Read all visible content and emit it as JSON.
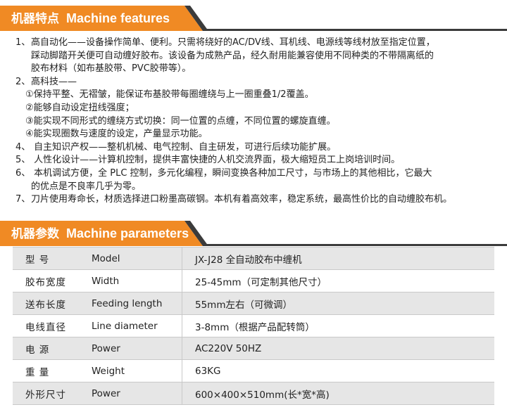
{
  "features_banner": {
    "cn": "机器特点",
    "en": "Machine features"
  },
  "features": [
    {
      "num": "1、",
      "lines": [
        "高自动化——设备操作简单、便利。只需将绕好的AC/DV线、耳机线、电源线等线材放至指定位置，",
        "踩动脚踏开关便可自动缠好胶布。该设备为成熟产品，经久耐用能兼容使用不同种类的不带隔离纸的",
        "胶布材料（如布基胶带、PVC胶带等）。"
      ]
    },
    {
      "num": "2、",
      "lines": [
        "高科技——"
      ]
    },
    {
      "sub": [
        "①保持平整、无褶皱，能保证布基胶带每圈缠绕与上一圈重叠1/2覆盖。",
        "②能够自动设定扭线强度；",
        "③能实现不同形式的缠绕方式切换：同一位置的点缠，不同位置的螺旋直缠。",
        "④能实现圈数与速度的设定，产量显示功能。"
      ]
    },
    {
      "num": "4、",
      "lines": [
        " 自主知识产权——整机机械、电气控制、自主研发，可进行后续功能扩展。"
      ]
    },
    {
      "num": "5、",
      "lines": [
        " 人性化设计——计算机控制，提供丰富快捷的人机交流界面，极大缩短员工上岗培训时间。"
      ]
    },
    {
      "num": "6、",
      "lines": [
        " 本机调试方便，全 PLC 控制，多元化编程，瞬间变换各种加工尺寸，与市场上的其他相比，它最大",
        " 的优点是不良率几乎为零。"
      ]
    },
    {
      "num": "7、",
      "lines": [
        "刀片使用寿命长，材质选择进口粉墨高碳钢。本机有着高效率，稳定系统，最高性价比的自动缠胶布机。"
      ]
    }
  ],
  "params_banner": {
    "cn": "机器参数",
    "en": "Machine parameters"
  },
  "params": [
    {
      "cn": "型   号",
      "en": "Model",
      "value": "JX-J28 全自动胶布中缠机"
    },
    {
      "cn": "胶布宽度",
      "en": "Width",
      "value": "25-45mm（可定制其他尺寸）"
    },
    {
      "cn": "送布长度",
      "en": "Feeding length",
      "value": "55mm左右（可微调）"
    },
    {
      "cn": "电线直径",
      "en": "Line diameter",
      "value": "3-8mm（根据产品配转筒）"
    },
    {
      "cn": "电   源",
      "en": "Power",
      "value": "AC220V  50HZ"
    },
    {
      "cn": "重   量",
      "en": "Weight",
      "value": "63KG"
    },
    {
      "cn": "外形尺寸",
      "en": "Power",
      "value": "600×400×510mm(长*宽*高)"
    }
  ],
  "colors": {
    "accent": "#f08a24",
    "dark": "#3b3b3b",
    "row_alt": "#e6e6e6"
  }
}
